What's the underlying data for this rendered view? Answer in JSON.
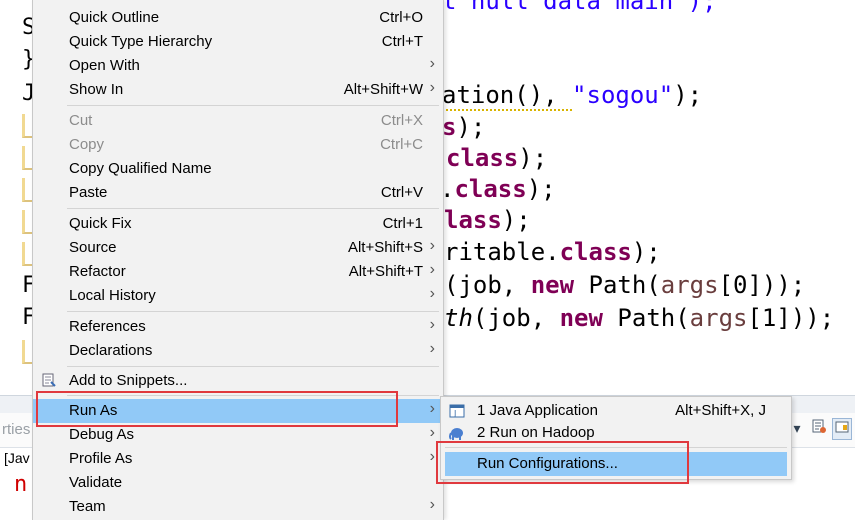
{
  "code": {
    "line0_text": "t null data main\");",
    "line1_head": "ation(), ",
    "line1_str": "\"sogou\"",
    "line1_tail": ");",
    "line2_var": "s",
    "line2_tail": ");",
    "line3_kw": "class",
    "line3_tail": ");",
    "line4_dot": ".",
    "line4_kw": "class",
    "line4_tail": ");",
    "line5_kw": "lass",
    "line5_tail": ");",
    "line6_head": "ritable.",
    "line6_kw": "class",
    "line6_tail": ");",
    "line7_a": "(job, ",
    "line7_kw": "new",
    "line7_b": " Path(",
    "line7_var": "args",
    "line7_c": "[0]));",
    "line8_it": "th",
    "line8_a": "(job, ",
    "line8_kw": "new",
    "line8_b": " Path(",
    "line8_var": "args",
    "line8_c": "[1]));",
    "gutter": [
      "S",
      "}",
      "J",
      "J",
      "J",
      "J",
      "J",
      "J",
      "F",
      "F",
      "J"
    ]
  },
  "bottom_panel": {
    "tab_fragment": "rties",
    "row_fragment": "[Jav",
    "console_fragment": "n"
  },
  "menu": {
    "items": [
      {
        "label": "Quick Outline",
        "accel": "Ctrl+O"
      },
      {
        "label": "Quick Type Hierarchy",
        "accel": "Ctrl+T"
      },
      {
        "label": "Open With",
        "accel": ""
      },
      {
        "label": "Show In",
        "accel": "Alt+Shift+W"
      },
      {
        "label": "Cut",
        "accel": "Ctrl+X"
      },
      {
        "label": "Copy",
        "accel": "Ctrl+C"
      },
      {
        "label": "Copy Qualified Name",
        "accel": ""
      },
      {
        "label": "Paste",
        "accel": "Ctrl+V"
      },
      {
        "label": "Quick Fix",
        "accel": "Ctrl+1"
      },
      {
        "label": "Source",
        "accel": "Alt+Shift+S"
      },
      {
        "label": "Refactor",
        "accel": "Alt+Shift+T"
      },
      {
        "label": "Local History",
        "accel": ""
      },
      {
        "label": "References",
        "accel": ""
      },
      {
        "label": "Declarations",
        "accel": ""
      },
      {
        "label": "Add to Snippets...",
        "accel": ""
      },
      {
        "label": "Run As",
        "accel": ""
      },
      {
        "label": "Debug As",
        "accel": ""
      },
      {
        "label": "Profile As",
        "accel": ""
      },
      {
        "label": "Validate",
        "accel": ""
      },
      {
        "label": "Team",
        "accel": ""
      }
    ]
  },
  "submenu": {
    "items": [
      {
        "label": "1 Java Application",
        "accel": "Alt+Shift+X, J"
      },
      {
        "label": "2 Run on Hadoop",
        "accel": ""
      },
      {
        "label": "Run Configurations...",
        "accel": ""
      }
    ]
  },
  "colors": {
    "highlight": "#91c9f7",
    "annotation_box": "#e0393e",
    "keyword": "#7f0055",
    "string": "#2a00ff"
  }
}
